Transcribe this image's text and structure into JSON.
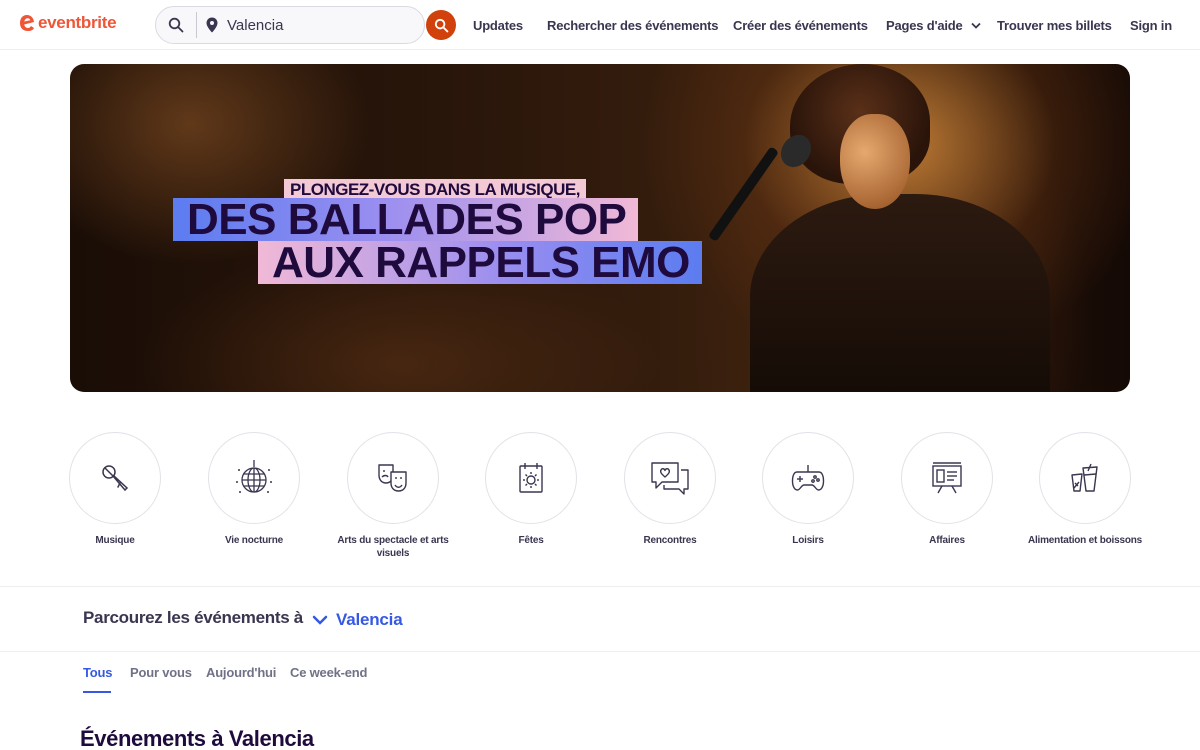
{
  "header": {
    "logo_text": "eventbrite",
    "search": {
      "location_value": "Valencia"
    },
    "nav": {
      "updates": "Updates",
      "find_events": "Rechercher des événements",
      "create_events": "Créer des événements",
      "help": "Pages d'aide",
      "tickets": "Trouver mes billets",
      "signin": "Sign in"
    }
  },
  "hero": {
    "line1": "PLONGEZ-VOUS DANS LA MUSIQUE,",
    "line2": "DES BALLADES POP",
    "line3": "AUX RAPPELS EMO"
  },
  "categories": [
    {
      "label": "Musique",
      "icon": "microphone-icon"
    },
    {
      "label": "Vie nocturne",
      "icon": "disco-ball-icon"
    },
    {
      "label": "Arts du spectacle et arts visuels",
      "icon": "theater-masks-icon"
    },
    {
      "label": "Fêtes",
      "icon": "calendar-sun-icon"
    },
    {
      "label": "Rencontres",
      "icon": "chat-heart-icon"
    },
    {
      "label": "Loisirs",
      "icon": "gamepad-icon"
    },
    {
      "label": "Affaires",
      "icon": "presentation-icon"
    },
    {
      "label": "Alimentation et boissons",
      "icon": "drinks-icon"
    }
  ],
  "browse": {
    "label": "Parcourez les événements à",
    "location": "Valencia"
  },
  "tabs": [
    "Tous",
    "Pour vous",
    "Aujourd'hui",
    "Ce week-end"
  ],
  "events_heading": "Événements à Valencia",
  "colors": {
    "brand": "#f05537",
    "search_button": "#d1410c",
    "link_blue": "#3659e3",
    "text_dark": "#1e0a3c"
  }
}
